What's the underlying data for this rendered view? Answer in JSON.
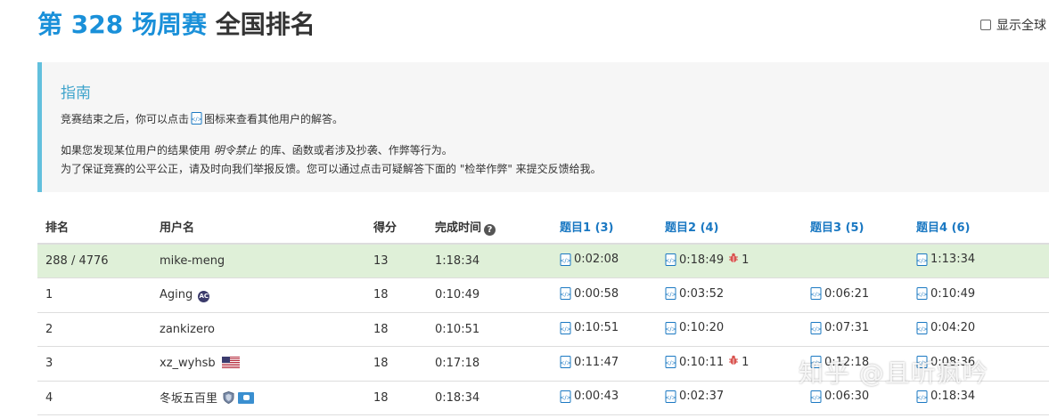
{
  "title": {
    "contest": "第 328 场周赛",
    "rank": "全国排名"
  },
  "show_global": {
    "label": "显示全球"
  },
  "guide": {
    "heading": "指南",
    "line1_pre": "竞赛结束之后，你可以点击",
    "line1_post": "图标来查看其他用户的解答。",
    "line2_pre": "如果您发现某位用户的结果使用",
    "line2_em": "明令禁止",
    "line2_post": "的库、函数或者涉及抄袭、作弊等行为。",
    "line3": "为了保证竞赛的公平公正，请及时向我们举报反馈。您可以通过点击可疑解答下面的 \"检举作弊\" 来提交反馈给我。"
  },
  "table": {
    "headers": {
      "rank": "排名",
      "user": "用户名",
      "score": "得分",
      "time": "完成时间",
      "q1": "题目1 (3)",
      "q2": "题目2 (4)",
      "q3": "题目3 (5)",
      "q4": "题目4 (6)"
    },
    "rows": [
      {
        "rank": "288 / 4776",
        "user": "mike-meng",
        "score": "13",
        "time": "1:18:34",
        "q1": "0:02:08",
        "q2": "0:18:49",
        "q2_bugs": "1",
        "q3": "",
        "q4": "1:13:34"
      },
      {
        "rank": "1",
        "user": "Aging",
        "score": "18",
        "time": "0:10:49",
        "q1": "0:00:58",
        "q2": "0:03:52",
        "q3": "0:06:21",
        "q4": "0:10:49"
      },
      {
        "rank": "2",
        "user": "zankizero",
        "score": "18",
        "time": "0:10:51",
        "q1": "0:10:51",
        "q2": "0:10:20",
        "q3": "0:07:31",
        "q4": "0:04:20"
      },
      {
        "rank": "3",
        "user": "xz_wyhsb",
        "score": "18",
        "time": "0:17:18",
        "q1": "0:11:47",
        "q2": "0:10:11",
        "q2_bugs": "1",
        "q3": "0:12:18",
        "q4": "0:08:36"
      },
      {
        "rank": "4",
        "user": "冬坂五百里",
        "score": "18",
        "time": "0:18:34",
        "q1": "0:00:43",
        "q2": "0:02:37",
        "q3": "0:06:30",
        "q4": "0:18:34"
      }
    ]
  },
  "watermark": "知乎 @且听疯吟",
  "icons": {
    "solution": "code-file-icon",
    "wrong": "bug-icon",
    "info": "question-circle-icon"
  },
  "colors": {
    "accent": "#1a90d9",
    "question_header": "#1a78c2",
    "highlight_row": "#dff0d8",
    "guide_border": "#62c0dd",
    "bug": "#d9534f"
  }
}
